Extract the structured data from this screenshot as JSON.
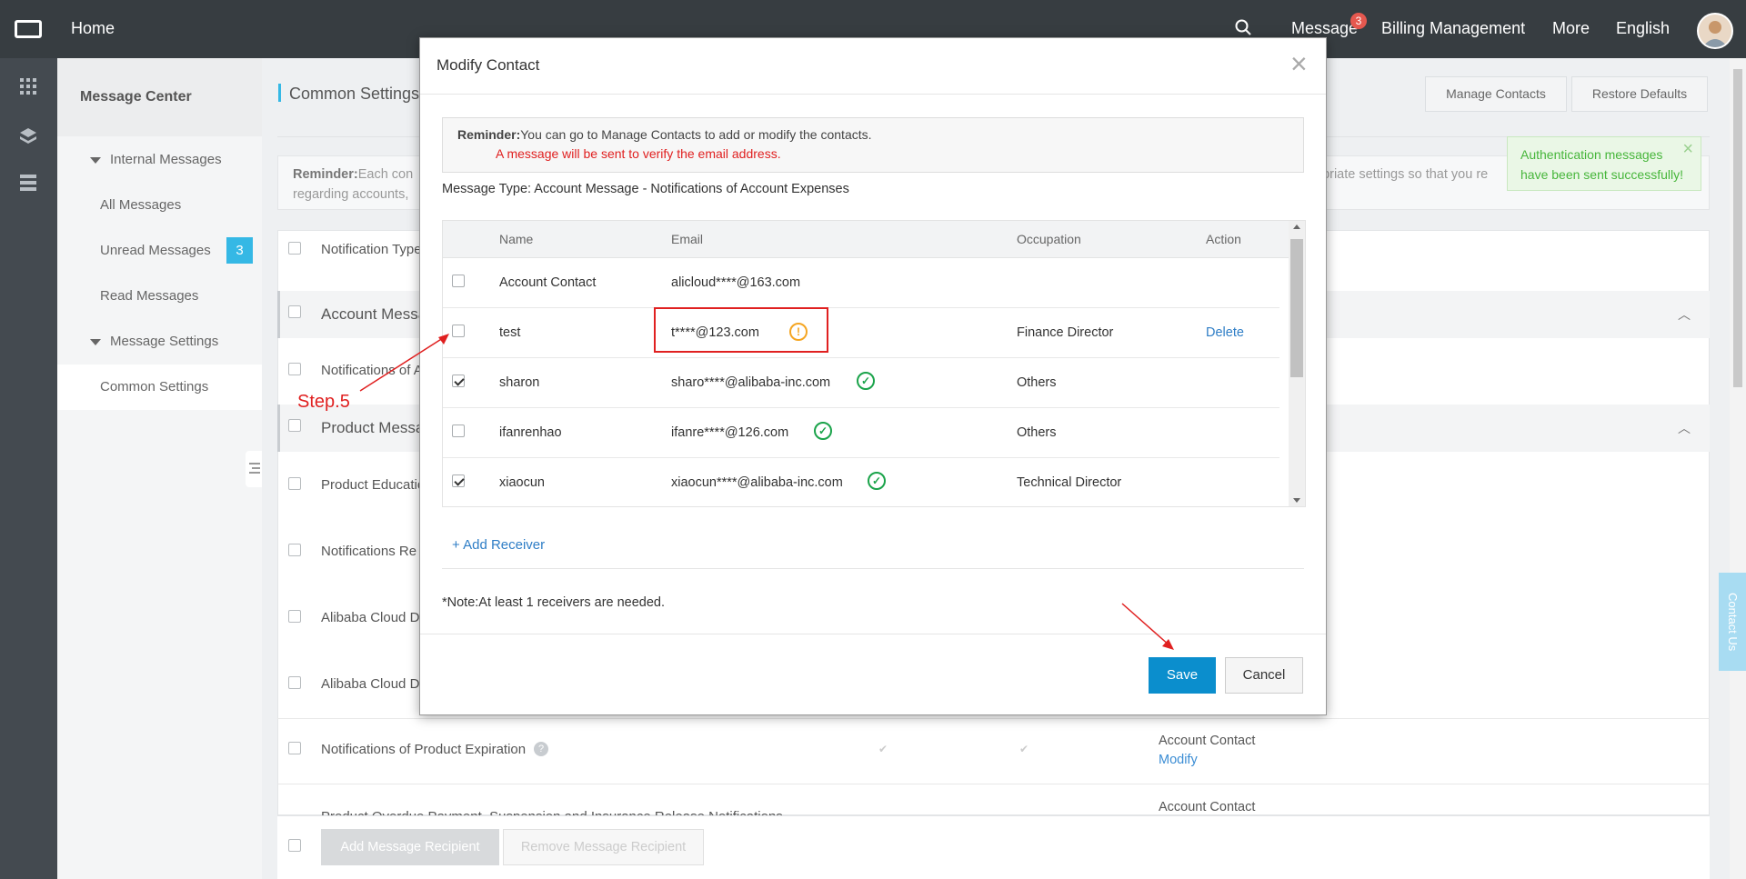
{
  "topbar": {
    "home": "Home",
    "message": "Message",
    "message_count": "3",
    "billing": "Billing Management",
    "more": "More",
    "language": "English"
  },
  "sidebar": {
    "title": "Message Center",
    "internal_messages": "Internal Messages",
    "all_messages": "All Messages",
    "unread_messages": "Unread Messages",
    "unread_count": "3",
    "read_messages": "Read Messages",
    "message_settings": "Message Settings",
    "common_settings": "Common Settings"
  },
  "main": {
    "title": "Common Settings",
    "manage_contacts": "Manage Contacts",
    "restore_defaults": "Restore Defaults",
    "reminder_label": "Reminder:",
    "reminder_text_left": "Each con",
    "reminder_text_right": "opriate settings so that you re",
    "reminder_line2": "regarding accounts,",
    "notification_type": "Notification Type",
    "account_messages": "Account Messa",
    "notifications_of_a": "Notifications of A",
    "product_messages": "Product Messa",
    "product_education": "Product Educatio",
    "notifications_re": "Notifications Re",
    "alibaba_cloud_1": "Alibaba Cloud D",
    "alibaba_cloud_2": "Alibaba Cloud D",
    "product_expiration": "Notifications of Product Expiration",
    "product_overdue": "Product Overdue Payment, Suspension and Insurance Release Notifications",
    "account_contact_1": "Account Contact",
    "modify": "Modify",
    "account_contact_2": "Account Contact",
    "add_recipient": "Add Message Recipient",
    "remove_recipient": "Remove Message Recipient"
  },
  "toast": {
    "text": "Authentication messages have been sent successfully!"
  },
  "contact_us": "Contact Us",
  "annotation": {
    "step": "Step.5"
  },
  "modal": {
    "title": "Modify Contact",
    "reminder_label": "Reminder:",
    "reminder_text": "You can go to Manage Contacts to add or modify the contacts.",
    "verify_text": "A message will be sent to verify the email address.",
    "message_type": "Message Type: Account Message - Notifications of Account Expenses",
    "columns": {
      "name": "Name",
      "email": "Email",
      "occupation": "Occupation",
      "action": "Action"
    },
    "rows": [
      {
        "name": "Account Contact",
        "email": "alicloud****@163.com",
        "occupation": "",
        "action": "",
        "checked": false
      },
      {
        "name": "test",
        "email": "t****@123.com",
        "occupation": "Finance Director",
        "action": "Delete",
        "checked": false
      },
      {
        "name": "sharon",
        "email": "sharo****@alibaba-inc.com",
        "occupation": "Others",
        "action": "",
        "checked": true
      },
      {
        "name": "ifanrenhao",
        "email": "ifanre****@126.com",
        "occupation": "Others",
        "action": "",
        "checked": false
      },
      {
        "name": "xiaocun",
        "email": "xiaocun****@alibaba-inc.com",
        "occupation": "Technical Director",
        "action": "",
        "checked": true
      }
    ],
    "add_receiver": "+ Add Receiver",
    "note": "*Note:At least 1 receivers are needed.",
    "save": "Save",
    "cancel": "Cancel"
  },
  "colors": {
    "topbar": "#373d41",
    "accent": "#0b8ecd",
    "success": "#1aa34a",
    "warning": "#f5a623",
    "error": "#e02020"
  }
}
